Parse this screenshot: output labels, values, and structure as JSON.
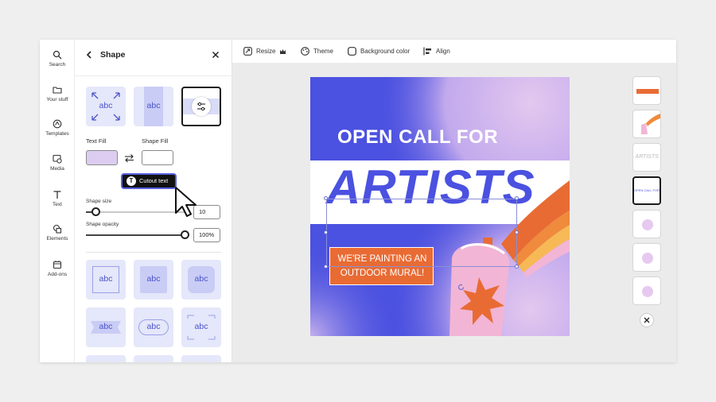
{
  "nav": {
    "items": [
      {
        "label": "Search",
        "icon": "search-icon"
      },
      {
        "label": "Your stuff",
        "icon": "folder-icon"
      },
      {
        "label": "Templates",
        "icon": "templates-icon"
      },
      {
        "label": "Media",
        "icon": "media-icon"
      },
      {
        "label": "Text",
        "icon": "text-icon"
      },
      {
        "label": "Elements",
        "icon": "elements-icon"
      },
      {
        "label": "Add-ons",
        "icon": "add-ons-icon"
      }
    ]
  },
  "panel": {
    "title": "Shape",
    "shape_tiles_top": [
      {
        "text": "abc",
        "style": "arrows"
      },
      {
        "text": "abc",
        "style": "band"
      },
      {
        "text": "",
        "style": "adjust",
        "selected": true
      }
    ],
    "text_fill_label": "Text Fill",
    "shape_fill_label": "Shape Fill",
    "text_fill_color": "#dccdf0",
    "shape_fill_color": "#ffffff",
    "tooltip": "Cutout text",
    "shape_size_label": "Shape size",
    "shape_size_value": "10",
    "shape_size_fraction": 0.1,
    "shape_opacity_label": "Shape opacity",
    "shape_opacity_value": "100%",
    "shape_opacity_fraction": 1.0,
    "shape_tiles_grid": [
      {
        "text": "abc"
      },
      {
        "text": "abc"
      },
      {
        "text": "abc"
      },
      {
        "text": "abc"
      },
      {
        "text": "abc"
      },
      {
        "text": "abc"
      }
    ]
  },
  "toolbar": {
    "resize": "Resize",
    "theme": "Theme",
    "background_color": "Background color",
    "align": "Align"
  },
  "poster": {
    "subtitle": "OPEN CALL FOR",
    "headline": "ARTISTS",
    "tagline_line1": "WE'RE PAINTING AN",
    "tagline_line2": "OUTDOOR MURAL!",
    "colors": {
      "blue": "#4b51e0",
      "orange": "#e96b34",
      "lavender": "#e3c8ef",
      "pink": "#f2b5d6",
      "stripe_orange": "#f08a3c",
      "stripe_yellow": "#f7b955"
    }
  },
  "pages": {
    "thumb_texts": [
      "",
      "",
      "ARTISTS",
      "OPEN CALL FOR",
      "",
      "",
      ""
    ],
    "active_index": 3
  },
  "colors": {
    "accent": "#5a5fe0",
    "tile_bg": "#e5e7fa",
    "tile_text": "#4a52c9"
  }
}
